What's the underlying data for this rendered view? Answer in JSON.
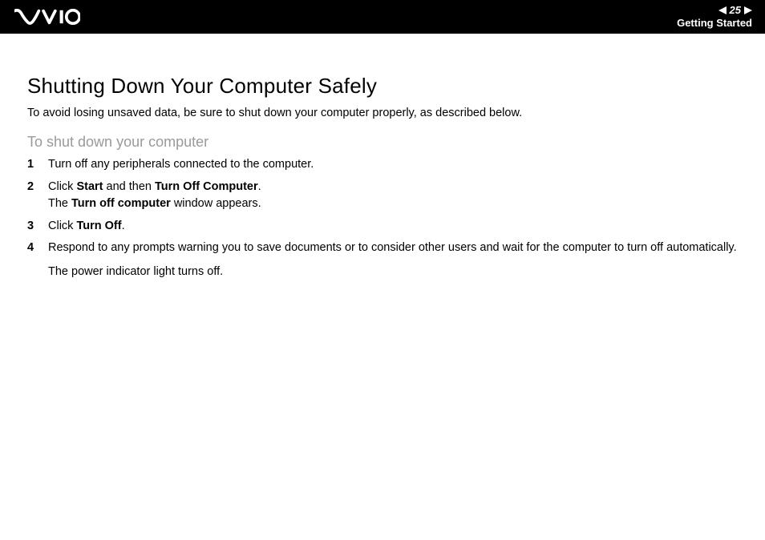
{
  "header": {
    "page_number": "25",
    "section": "Getting Started"
  },
  "content": {
    "title": "Shutting Down Your Computer Safely",
    "intro": "To avoid losing unsaved data, be sure to shut down your computer properly, as described below.",
    "subtitle": "To shut down your computer",
    "steps": {
      "s1": "Turn off any peripherals connected to the computer.",
      "s2_a": "Click ",
      "s2_b": "Start",
      "s2_c": " and then ",
      "s2_d": "Turn Off Computer",
      "s2_e": ".",
      "s2_f": "The ",
      "s2_g": "Turn off computer",
      "s2_h": " window appears.",
      "s3_a": "Click ",
      "s3_b": "Turn Off",
      "s3_c": ".",
      "s4_a": "Respond to any prompts warning you to save documents or to consider other users and wait for the computer to turn off automatically.",
      "s4_b": "The power indicator light turns off."
    }
  }
}
